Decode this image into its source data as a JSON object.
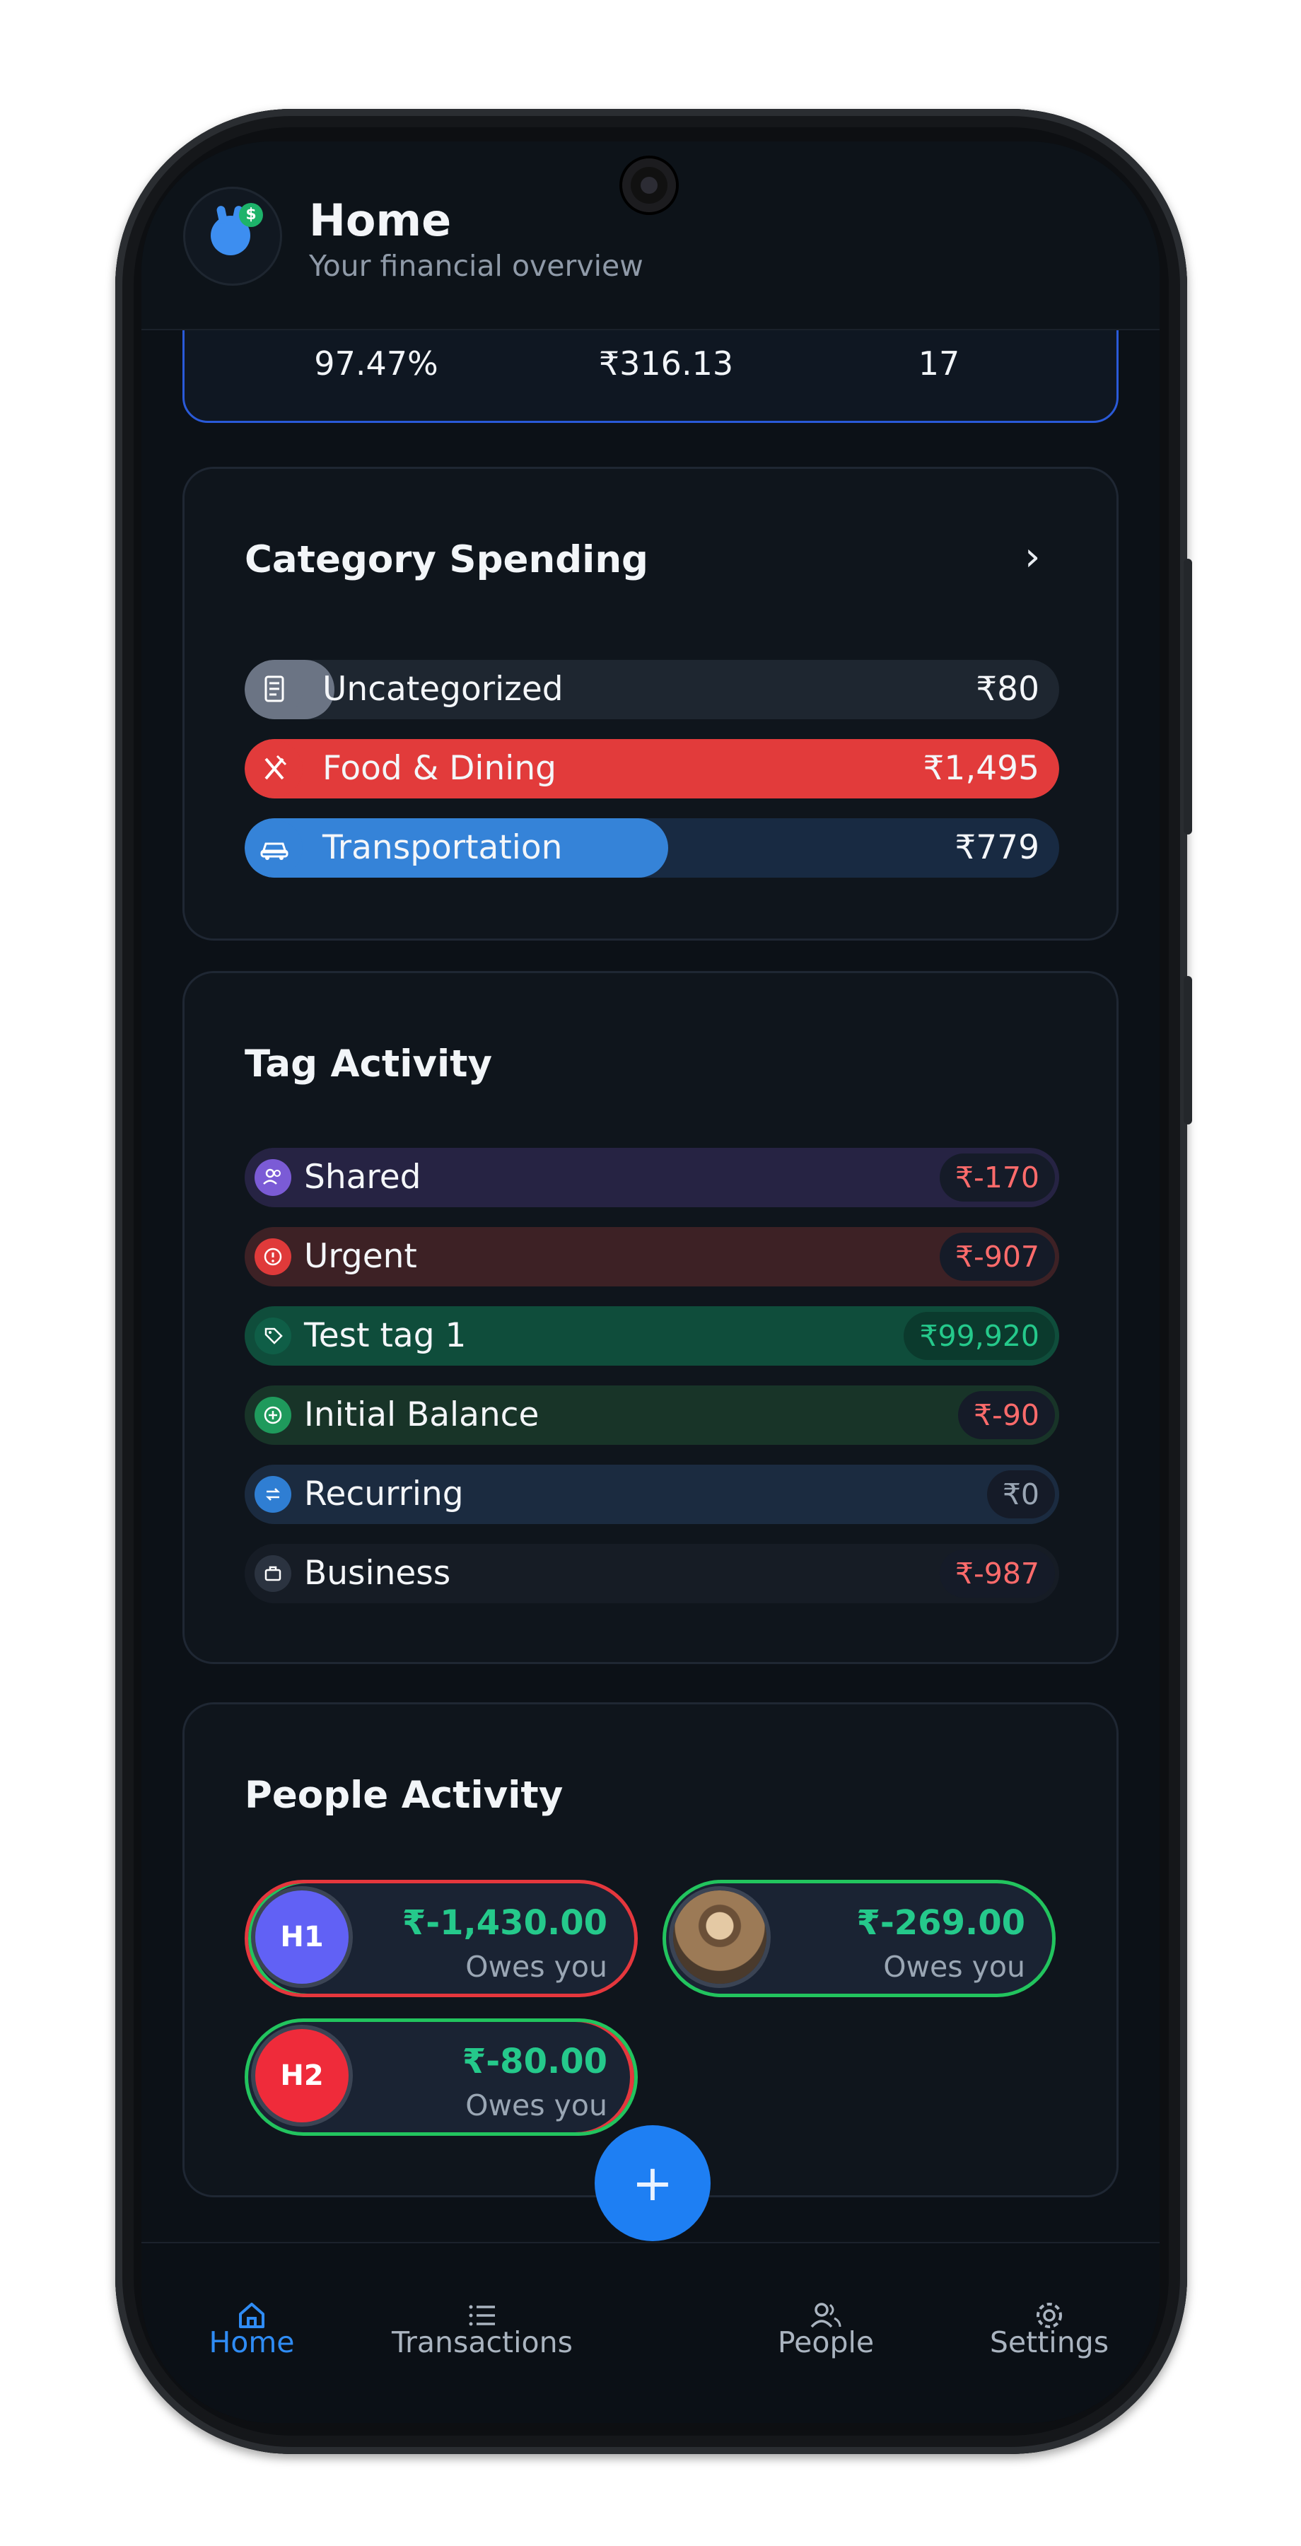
{
  "header": {
    "title": "Home",
    "subtitle": "Your financial overview",
    "logo_icon": "bunny-dollar-logo"
  },
  "stats": {
    "savings_rate": "97.47%",
    "avg_daily": "₹316.13",
    "count": "17"
  },
  "category_spending": {
    "title": "Category Spending",
    "items": [
      {
        "label": "Uncategorized",
        "amount": "₹80",
        "icon": "receipt-icon",
        "color": "#6b7484",
        "fill": 0.11
      },
      {
        "label": "Food & Dining",
        "amount": "₹1,495",
        "icon": "utensils-icon",
        "color": "#e23b3b",
        "fill": 1.0
      },
      {
        "label": "Transportation",
        "amount": "₹779",
        "icon": "car-icon",
        "color": "#3583d8",
        "fill": 0.52
      }
    ]
  },
  "tag_activity": {
    "title": "Tag Activity",
    "items": [
      {
        "label": "Shared",
        "amount": "₹-170",
        "icon": "users-icon",
        "dot": "#7b5bd6",
        "bg": "#262343",
        "amount_color": "#ff6b6b"
      },
      {
        "label": "Urgent",
        "amount": "₹-907",
        "icon": "alert-icon",
        "dot": "#e03a3a",
        "bg": "#3d2125",
        "amount_color": "#ff6b6b"
      },
      {
        "label": "Test tag 1",
        "amount": "₹99,920",
        "icon": "tag-icon",
        "dot": "#0f5e47",
        "bg": "#0f4d3b",
        "amount_color": "#25c98b"
      },
      {
        "label": "Initial Balance",
        "amount": "₹-90",
        "icon": "plus-circle-icon",
        "dot": "#1f9a5c",
        "bg": "#183428",
        "amount_color": "#ff6b6b"
      },
      {
        "label": "Recurring",
        "amount": "₹0",
        "icon": "repeat-icon",
        "dot": "#2f7ed3",
        "bg": "#1b2b40",
        "amount_color": "#9aa6b4"
      },
      {
        "label": "Business",
        "amount": "₹-987",
        "icon": "briefcase-icon",
        "dot": "#2b3340",
        "bg": "#161c25",
        "amount_color": "#ff6b6b"
      }
    ]
  },
  "people_activity": {
    "title": "People Activity",
    "people": [
      {
        "initials": "H1",
        "amount": "₹-1,430.00",
        "status": "Owes you",
        "avatar_color": "#6161f5"
      },
      {
        "initials": "",
        "amount": "₹-269.00",
        "status": "Owes you",
        "avatar_color": "#8a6a48"
      },
      {
        "initials": "H2",
        "amount": "₹-80.00",
        "status": "Owes you",
        "avatar_color": "#ef2b3a"
      }
    ]
  },
  "nav": {
    "items": [
      {
        "label": "Home",
        "icon": "home-icon",
        "active": true
      },
      {
        "label": "Transactions",
        "icon": "list-icon",
        "active": false
      },
      {
        "label": "People",
        "icon": "people-icon",
        "active": false
      },
      {
        "label": "Settings",
        "icon": "gear-icon",
        "active": false
      }
    ],
    "fab_label": "+",
    "active_color": "#2f8cf5"
  }
}
